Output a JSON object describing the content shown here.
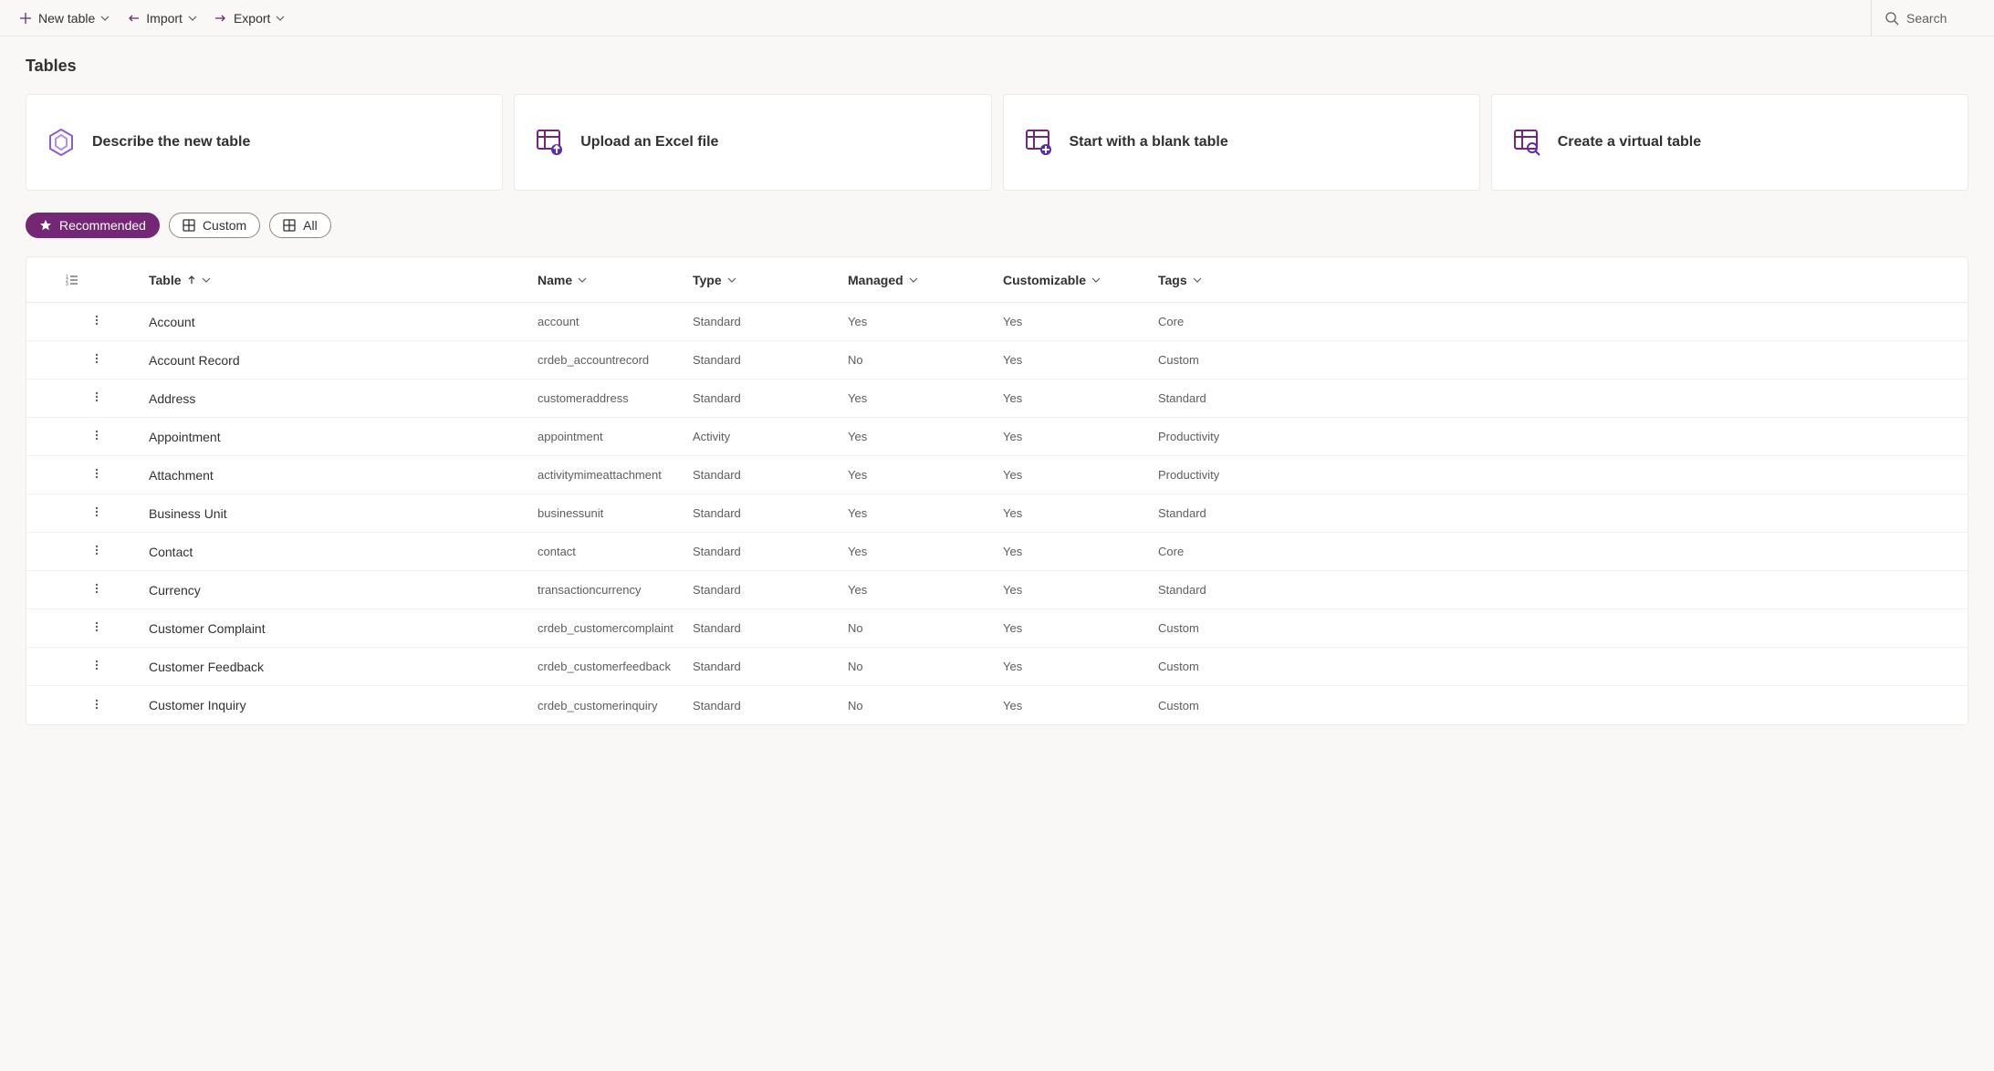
{
  "toolbar": {
    "new_table": "New table",
    "import": "Import",
    "export": "Export",
    "search_placeholder": "Search"
  },
  "page": {
    "title": "Tables"
  },
  "cards": [
    {
      "label": "Describe the new table"
    },
    {
      "label": "Upload an Excel file"
    },
    {
      "label": "Start with a blank table"
    },
    {
      "label": "Create a virtual table"
    }
  ],
  "pills": {
    "recommended": "Recommended",
    "custom": "Custom",
    "all": "All"
  },
  "columns": {
    "table": "Table",
    "name": "Name",
    "type": "Type",
    "managed": "Managed",
    "customizable": "Customizable",
    "tags": "Tags"
  },
  "rows": [
    {
      "display": "Account",
      "name": "account",
      "type": "Standard",
      "managed": "Yes",
      "customizable": "Yes",
      "tags": "Core"
    },
    {
      "display": "Account Record",
      "name": "crdeb_accountrecord",
      "type": "Standard",
      "managed": "No",
      "customizable": "Yes",
      "tags": "Custom"
    },
    {
      "display": "Address",
      "name": "customeraddress",
      "type": "Standard",
      "managed": "Yes",
      "customizable": "Yes",
      "tags": "Standard"
    },
    {
      "display": "Appointment",
      "name": "appointment",
      "type": "Activity",
      "managed": "Yes",
      "customizable": "Yes",
      "tags": "Productivity"
    },
    {
      "display": "Attachment",
      "name": "activitymimeattachment",
      "type": "Standard",
      "managed": "Yes",
      "customizable": "Yes",
      "tags": "Productivity"
    },
    {
      "display": "Business Unit",
      "name": "businessunit",
      "type": "Standard",
      "managed": "Yes",
      "customizable": "Yes",
      "tags": "Standard"
    },
    {
      "display": "Contact",
      "name": "contact",
      "type": "Standard",
      "managed": "Yes",
      "customizable": "Yes",
      "tags": "Core"
    },
    {
      "display": "Currency",
      "name": "transactioncurrency",
      "type": "Standard",
      "managed": "Yes",
      "customizable": "Yes",
      "tags": "Standard"
    },
    {
      "display": "Customer Complaint",
      "name": "crdeb_customercomplaint",
      "type": "Standard",
      "managed": "No",
      "customizable": "Yes",
      "tags": "Custom"
    },
    {
      "display": "Customer Feedback",
      "name": "crdeb_customerfeedback",
      "type": "Standard",
      "managed": "No",
      "customizable": "Yes",
      "tags": "Custom"
    },
    {
      "display": "Customer Inquiry",
      "name": "crdeb_customerinquiry",
      "type": "Standard",
      "managed": "No",
      "customizable": "Yes",
      "tags": "Custom"
    }
  ]
}
